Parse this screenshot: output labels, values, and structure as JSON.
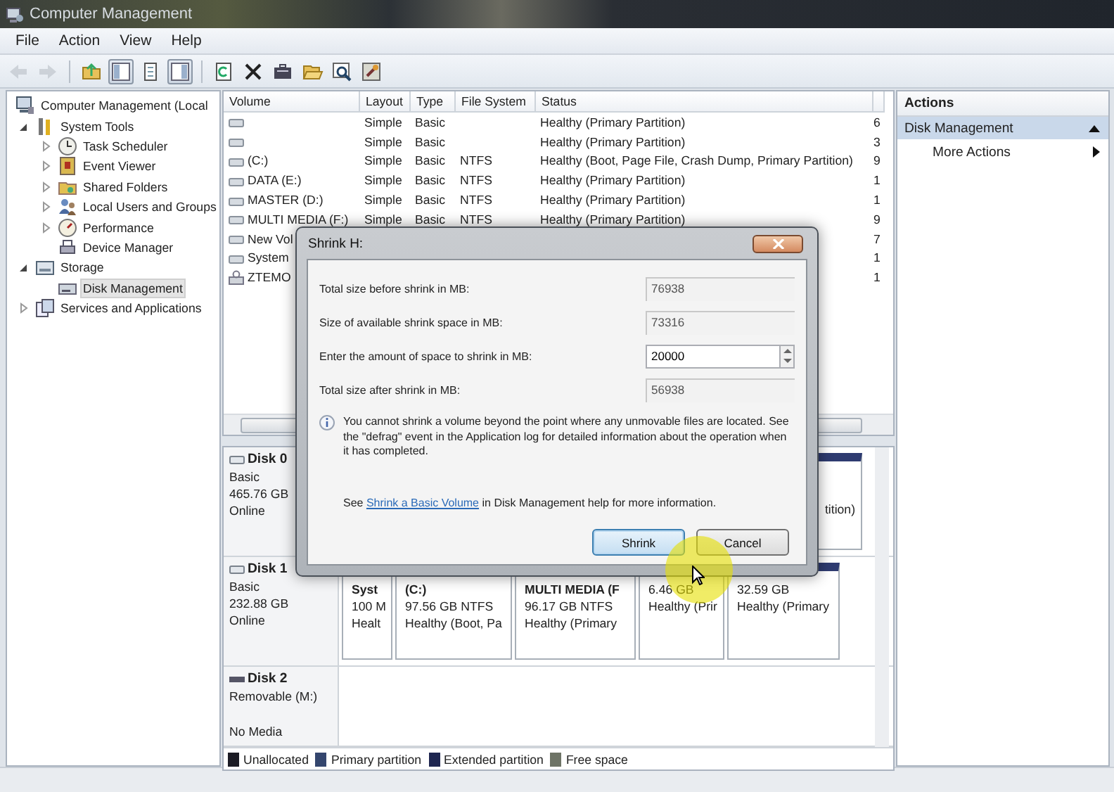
{
  "window": {
    "title": "Computer Management"
  },
  "menu": [
    {
      "label": "File"
    },
    {
      "label": "Action"
    },
    {
      "label": "View"
    },
    {
      "label": "Help"
    }
  ],
  "toolbar": [
    {
      "kind": "back",
      "disabled": true,
      "pressed": false
    },
    {
      "kind": "forward",
      "disabled": true,
      "pressed": false
    },
    {
      "kind": "up",
      "disabled": false,
      "pressed": false
    },
    {
      "kind": "tree",
      "disabled": false,
      "pressed": true
    },
    {
      "kind": "properties",
      "disabled": false,
      "pressed": false
    },
    {
      "kind": "actionpane",
      "disabled": false,
      "pressed": true
    },
    {
      "kind": "refresh",
      "disabled": false,
      "pressed": false
    },
    {
      "kind": "delete",
      "disabled": false,
      "pressed": false
    },
    {
      "kind": "briefcase",
      "disabled": false,
      "pressed": false
    },
    {
      "kind": "open",
      "disabled": false,
      "pressed": false
    },
    {
      "kind": "search",
      "disabled": false,
      "pressed": false
    },
    {
      "kind": "wizard",
      "disabled": false,
      "pressed": false
    }
  ],
  "tree": [
    {
      "label": "Computer Management (Local",
      "kind": "computer",
      "expandable": false,
      "selected": false,
      "children": [
        {
          "label": "System Tools",
          "kind": "tools",
          "expandable": true,
          "expanded": true,
          "selected": false,
          "children": [
            {
              "label": "Task Scheduler",
              "kind": "clock",
              "expandable": true,
              "expanded": false,
              "selected": false
            },
            {
              "label": "Event Viewer",
              "kind": "event",
              "expandable": true,
              "expanded": false,
              "selected": false
            },
            {
              "label": "Shared Folders",
              "kind": "share",
              "expandable": true,
              "expanded": false,
              "selected": false
            },
            {
              "label": "Local Users and Groups",
              "kind": "users",
              "expandable": true,
              "expanded": false,
              "selected": false
            },
            {
              "label": "Performance",
              "kind": "performance",
              "expandable": true,
              "expanded": false,
              "selected": false
            },
            {
              "label": "Device Manager",
              "kind": "device",
              "expandable": false,
              "selected": false
            }
          ]
        },
        {
          "label": "Storage",
          "kind": "storage",
          "expandable": true,
          "expanded": true,
          "selected": false,
          "children": [
            {
              "label": "Disk Management",
              "kind": "disk",
              "expandable": false,
              "selected": true
            }
          ]
        },
        {
          "label": "Services and Applications",
          "kind": "services",
          "expandable": true,
          "expanded": false,
          "selected": false
        }
      ]
    }
  ],
  "volume_table": {
    "columns": [
      "Volume",
      "Layout",
      "Type",
      "File System",
      "Status"
    ],
    "rows": [
      {
        "kind": "disk",
        "layout": "Simple",
        "type": "Basic",
        "status": "Healthy (Primary Partition)",
        "column_6": "6"
      },
      {
        "kind": "disk",
        "layout": "Simple",
        "type": "Basic",
        "status": "Healthy (Primary Partition)",
        "column_6": "3"
      },
      {
        "kind": "disk",
        "volume": "(C:)",
        "layout": "Simple",
        "type": "Basic",
        "file_system": "NTFS",
        "status": "Healthy (Boot, Page File, Crash Dump, Primary Partition)",
        "column_6": "9"
      },
      {
        "kind": "disk",
        "volume": "DATA (E:)",
        "layout": "Simple",
        "type": "Basic",
        "file_system": "NTFS",
        "status": "Healthy (Primary Partition)",
        "column_6": "1"
      },
      {
        "kind": "disk",
        "volume": "MASTER (D:)",
        "layout": "Simple",
        "type": "Basic",
        "file_system": "NTFS",
        "status": "Healthy (Primary Partition)",
        "column_6": "1"
      },
      {
        "kind": "disk",
        "volume": "MULTI MEDIA (F:)",
        "layout": "Simple",
        "type": "Basic",
        "file_system": "NTFS",
        "status": "Healthy (Primary Partition)",
        "column_6": "9"
      },
      {
        "kind": "disk",
        "volume": "New Vol",
        "column_6": "7"
      },
      {
        "kind": "disk",
        "volume": "System",
        "column_6": "1"
      },
      {
        "kind": "removable",
        "volume": "ZTEMO",
        "column_6": "1"
      }
    ]
  },
  "disks": [
    {
      "name": "Disk 0",
      "kind": "disk",
      "lines": [
        "Basic",
        "465.76 GB",
        "Online"
      ],
      "partitions": [
        {
          "lines": [
            "tition)"
          ]
        }
      ]
    },
    {
      "name": "Disk 1",
      "kind": "disk",
      "lines": [
        "Basic",
        "232.88 GB",
        "Online"
      ],
      "partitions": [
        {
          "lines": [
            "Syst",
            "100 M",
            "Healt"
          ]
        },
        {
          "lines": [
            "(C:)",
            "97.56 GB NTFS",
            "Healthy (Boot, Pa"
          ]
        },
        {
          "lines": [
            "MULTI MEDIA  (F",
            "96.17 GB NTFS",
            "Healthy (Primary"
          ]
        },
        {
          "lines": [
            "6.46 GB",
            "Healthy (Prir"
          ]
        },
        {
          "lines": [
            "32.59 GB",
            "Healthy (Primary"
          ]
        }
      ]
    },
    {
      "name": "Disk 2",
      "kind": "removable",
      "lines": [
        "Removable (M:)"
      ],
      "footer": "No Media"
    }
  ],
  "legend": [
    {
      "label": "Unallocated",
      "color": "#1b1b24"
    },
    {
      "label": "Primary partition",
      "color": "#34466e"
    },
    {
      "label": "Extended partition",
      "color": "#1e2650"
    },
    {
      "label": "Free space",
      "color": "#6e7466"
    }
  ],
  "actions": {
    "title": "Actions",
    "sections": [
      {
        "label": "Disk Management",
        "expanded": true,
        "items": [
          {
            "label": "More Actions",
            "kind": "submenu"
          }
        ]
      }
    ]
  },
  "dialog": {
    "title": "Shrink H:",
    "fields": [
      {
        "label": "Total size before shrink in MB:",
        "value": "76938",
        "kind": "readonly"
      },
      {
        "label": "Size of available shrink space in MB:",
        "value": "73316",
        "kind": "readonly"
      },
      {
        "label": "Enter the amount of space to shrink in MB:",
        "value": "20000",
        "kind": "spin"
      },
      {
        "label": "Total size after shrink in MB:",
        "value": "56938",
        "kind": "readonly"
      }
    ],
    "info": "You cannot shrink a volume beyond the point where any unmovable files are located. See the \"defrag\" event in the Application log for detailed information about the operation when it has completed.",
    "help": {
      "before": "See ",
      "link": "Shrink a Basic Volume",
      "after": " in Disk Management help for more information."
    },
    "buttons": [
      {
        "label": "Shrink",
        "default": true
      },
      {
        "label": "Cancel",
        "default": false
      }
    ]
  }
}
